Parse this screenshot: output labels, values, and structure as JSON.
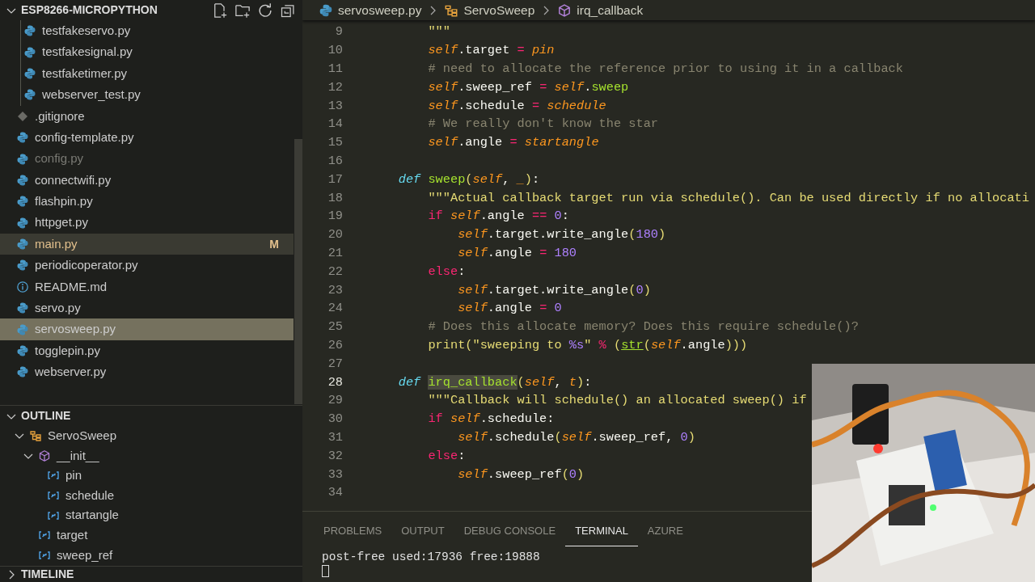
{
  "explorer": {
    "title": "ESP8266-MICROPYTHON",
    "expanded": true,
    "items": [
      {
        "children": [
          {
            "name": "testfakeservo.py",
            "kind": "python",
            "selected": false,
            "hovered": false,
            "modified": false,
            "ignored": false
          },
          {
            "name": "testfakesignal.py",
            "kind": "python",
            "selected": false,
            "hovered": false,
            "modified": false,
            "ignored": false
          },
          {
            "name": "testfaketimer.py",
            "kind": "python",
            "selected": false,
            "hovered": false,
            "modified": false,
            "ignored": false
          },
          {
            "name": "webserver_test.py",
            "kind": "python",
            "selected": false,
            "hovered": false,
            "modified": false,
            "ignored": false
          }
        ]
      },
      {
        "name": ".gitignore",
        "kind": "git",
        "selected": false,
        "hovered": false,
        "modified": false,
        "ignored": false
      },
      {
        "name": "config-template.py",
        "kind": "python",
        "selected": false,
        "hovered": false,
        "modified": false,
        "ignored": false
      },
      {
        "name": "config.py",
        "kind": "python",
        "selected": false,
        "hovered": false,
        "modified": false,
        "ignored": true
      },
      {
        "name": "connectwifi.py",
        "kind": "python",
        "selected": false,
        "hovered": false,
        "modified": false,
        "ignored": false
      },
      {
        "name": "flashpin.py",
        "kind": "python",
        "selected": false,
        "hovered": false,
        "modified": false,
        "ignored": false
      },
      {
        "name": "httpget.py",
        "kind": "python",
        "selected": false,
        "hovered": false,
        "modified": false,
        "ignored": false
      },
      {
        "name": "main.py",
        "kind": "python",
        "badge": "M",
        "selected": false,
        "hovered": true,
        "modified": true,
        "ignored": false
      },
      {
        "name": "periodicoperator.py",
        "kind": "python",
        "selected": false,
        "hovered": false,
        "modified": false,
        "ignored": false
      },
      {
        "name": "README.md",
        "kind": "info",
        "selected": false,
        "hovered": false,
        "modified": false,
        "ignored": false
      },
      {
        "name": "servo.py",
        "kind": "python",
        "selected": false,
        "hovered": false,
        "modified": false,
        "ignored": false
      },
      {
        "name": "servosweep.py",
        "kind": "python",
        "selected": true,
        "hovered": false,
        "modified": false,
        "ignored": false
      },
      {
        "name": "togglepin.py",
        "kind": "python",
        "selected": false,
        "hovered": false,
        "modified": false,
        "ignored": false
      },
      {
        "name": "webserver.py",
        "kind": "python",
        "selected": false,
        "hovered": false,
        "modified": false,
        "ignored": false
      }
    ]
  },
  "outline": {
    "title": "OUTLINE",
    "expanded": true,
    "items": [
      {
        "name": "ServoSweep",
        "kind": "class",
        "expanded": true,
        "children": [
          {
            "name": "__init__",
            "kind": "method",
            "expanded": true,
            "children": [
              {
                "name": "pin",
                "kind": "variable"
              },
              {
                "name": "schedule",
                "kind": "variable"
              },
              {
                "name": "startangle",
                "kind": "variable"
              }
            ]
          },
          {
            "name": "target",
            "kind": "variable"
          },
          {
            "name": "sweep_ref",
            "kind": "variable"
          }
        ]
      }
    ]
  },
  "timeline": {
    "title": "TIMELINE",
    "expanded": false
  },
  "editor": {
    "breadcrumb": [
      {
        "text": "servosweep.py",
        "kind": "python"
      },
      {
        "text": "ServoSweep",
        "kind": "class"
      },
      {
        "text": "irq_callback",
        "kind": "method"
      }
    ],
    "lines": [
      {
        "children": [
          {
            "children": [
              {
                "num": "9",
                "current": false,
                "tokens": [
                  {
                    "kind": "string",
                    "text": "\"\"\""
                  }
                ]
              },
              {
                "num": "10",
                "current": false,
                "tokens": [
                  {
                    "kind": "self",
                    "text": "self"
                  },
                  {
                    "kind": "plain",
                    "text": ".target "
                  },
                  {
                    "kind": "op",
                    "text": "="
                  },
                  {
                    "kind": "param",
                    "text": " pin"
                  }
                ]
              },
              {
                "num": "11",
                "current": false,
                "tokens": [
                  {
                    "kind": "comment",
                    "text": "# need to allocate the reference prior to using it in a callback"
                  }
                ]
              },
              {
                "num": "12",
                "current": false,
                "tokens": [
                  {
                    "kind": "self",
                    "text": "self"
                  },
                  {
                    "kind": "plain",
                    "text": ".sweep_ref "
                  },
                  {
                    "kind": "op",
                    "text": "= "
                  },
                  {
                    "kind": "self",
                    "text": "self"
                  },
                  {
                    "kind": "plain",
                    "text": "."
                  },
                  {
                    "kind": "attr",
                    "text": "sweep"
                  }
                ]
              },
              {
                "num": "13",
                "current": false,
                "tokens": [
                  {
                    "kind": "self",
                    "text": "self"
                  },
                  {
                    "kind": "plain",
                    "text": ".schedule "
                  },
                  {
                    "kind": "op",
                    "text": "="
                  },
                  {
                    "kind": "param",
                    "text": " schedule"
                  }
                ]
              },
              {
                "num": "14",
                "current": false,
                "tokens": [
                  {
                    "kind": "comment",
                    "text": "# We really don't know the star"
                  }
                ]
              },
              {
                "num": "15",
                "current": false,
                "tokens": [
                  {
                    "kind": "self",
                    "text": "self"
                  },
                  {
                    "kind": "plain",
                    "text": ".angle "
                  },
                  {
                    "kind": "op",
                    "text": "="
                  },
                  {
                    "kind": "param",
                    "text": " startangle"
                  }
                ]
              }
            ]
          },
          {
            "num": "16",
            "current": false
          },
          {
            "num": "17",
            "current": false,
            "tokens": [
              {
                "kind": "keyword",
                "text": "def"
              },
              {
                "kind": "func",
                "text": " sweep"
              },
              {
                "kind": "bracket",
                "text": "("
              },
              {
                "kind": "param",
                "text": "self"
              },
              {
                "kind": "plain",
                "text": ", "
              },
              {
                "kind": "param",
                "text": "_"
              },
              {
                "kind": "bracket",
                "text": ")"
              },
              {
                "kind": "plain",
                "text": ":"
              }
            ],
            "children": [
              {
                "num": "18",
                "current": false,
                "tokens": [
                  {
                    "kind": "string",
                    "text": "\"\"\"Actual callback target run via schedule(). Can be used directly if no allocati"
                  }
                ]
              },
              {
                "num": "19",
                "current": false,
                "tokens": [
                  {
                    "kind": "control",
                    "text": "if"
                  },
                  {
                    "kind": "self",
                    "text": " self"
                  },
                  {
                    "kind": "plain",
                    "text": ".angle "
                  },
                  {
                    "kind": "op",
                    "text": "=="
                  },
                  {
                    "kind": "number",
                    "text": " 0"
                  },
                  {
                    "kind": "plain",
                    "text": ":"
                  }
                ],
                "children": [
                  {
                    "num": "20",
                    "current": false,
                    "tokens": [
                      {
                        "kind": "self",
                        "text": "self"
                      },
                      {
                        "kind": "plain",
                        "text": ".target.write_angle"
                      },
                      {
                        "kind": "bracket",
                        "text": "("
                      },
                      {
                        "kind": "number",
                        "text": "180"
                      },
                      {
                        "kind": "bracket",
                        "text": ")"
                      }
                    ]
                  },
                  {
                    "num": "21",
                    "current": false,
                    "tokens": [
                      {
                        "kind": "self",
                        "text": "self"
                      },
                      {
                        "kind": "plain",
                        "text": ".angle "
                      },
                      {
                        "kind": "op",
                        "text": "="
                      },
                      {
                        "kind": "number",
                        "text": " 180"
                      }
                    ]
                  }
                ]
              },
              {
                "num": "22",
                "current": false,
                "tokens": [
                  {
                    "kind": "control",
                    "text": "else"
                  },
                  {
                    "kind": "plain",
                    "text": ":"
                  }
                ],
                "children": [
                  {
                    "num": "23",
                    "current": false,
                    "tokens": [
                      {
                        "kind": "self",
                        "text": "self"
                      },
                      {
                        "kind": "plain",
                        "text": ".target.write_angle"
                      },
                      {
                        "kind": "bracket",
                        "text": "("
                      },
                      {
                        "kind": "number",
                        "text": "0"
                      },
                      {
                        "kind": "bracket",
                        "text": ")"
                      }
                    ]
                  },
                  {
                    "num": "24",
                    "current": false,
                    "tokens": [
                      {
                        "kind": "self",
                        "text": "self"
                      },
                      {
                        "kind": "plain",
                        "text": ".angle "
                      },
                      {
                        "kind": "op",
                        "text": "="
                      },
                      {
                        "kind": "number",
                        "text": " 0"
                      }
                    ]
                  }
                ]
              },
              {
                "num": "25",
                "current": false,
                "tokens": [
                  {
                    "kind": "comment",
                    "text": "# Does this allocate memory? Does this require schedule()?"
                  }
                ]
              },
              {
                "num": "26",
                "current": false,
                "tokens": [
                  {
                    "kind": "string",
                    "text": "print"
                  },
                  {
                    "kind": "bracket",
                    "text": "("
                  },
                  {
                    "kind": "string",
                    "text": "\"sweeping to "
                  },
                  {
                    "kind": "number",
                    "text": "%s"
                  },
                  {
                    "kind": "string",
                    "text": "\""
                  },
                  {
                    "kind": "op",
                    "text": " % "
                  },
                  {
                    "kind": "bracket",
                    "text": "("
                  },
                  {
                    "kind": "builtin",
                    "text": "str"
                  },
                  {
                    "kind": "bracket",
                    "text": "("
                  },
                  {
                    "kind": "self",
                    "text": "self"
                  },
                  {
                    "kind": "plain",
                    "text": ".angle"
                  },
                  {
                    "kind": "bracket",
                    "text": ")))"
                  }
                ]
              }
            ]
          },
          {
            "num": "27",
            "current": false
          },
          {
            "num": "28",
            "current": true,
            "tokens": [
              {
                "kind": "keyword",
                "text": "def "
              },
              {
                "kind": "highlight",
                "text": "irq_callback"
              },
              {
                "kind": "bracket",
                "text": "("
              },
              {
                "kind": "param",
                "text": "self"
              },
              {
                "kind": "plain",
                "text": ", "
              },
              {
                "kind": "param",
                "text": "t"
              },
              {
                "kind": "bracket",
                "text": ")"
              },
              {
                "kind": "plain",
                "text": ":"
              }
            ],
            "children": [
              {
                "num": "29",
                "current": false,
                "tokens": [
                  {
                    "kind": "string",
                    "text": "\"\"\"Callback will schedule() an allocated sweep() if"
                  }
                ]
              },
              {
                "num": "30",
                "current": false,
                "tokens": [
                  {
                    "kind": "control",
                    "text": "if"
                  },
                  {
                    "kind": "self",
                    "text": " self"
                  },
                  {
                    "kind": "plain",
                    "text": ".schedule:"
                  }
                ],
                "children": [
                  {
                    "num": "31",
                    "current": false,
                    "tokens": [
                      {
                        "kind": "self",
                        "text": "self"
                      },
                      {
                        "kind": "plain",
                        "text": ".schedule"
                      },
                      {
                        "kind": "bracket",
                        "text": "("
                      },
                      {
                        "kind": "self",
                        "text": "self"
                      },
                      {
                        "kind": "plain",
                        "text": ".sweep_ref, "
                      },
                      {
                        "kind": "number",
                        "text": "0"
                      },
                      {
                        "kind": "bracket",
                        "text": ")"
                      }
                    ]
                  }
                ]
              },
              {
                "num": "32",
                "current": false,
                "tokens": [
                  {
                    "kind": "control",
                    "text": "else"
                  },
                  {
                    "kind": "plain",
                    "text": ":"
                  }
                ],
                "children": [
                  {
                    "num": "33",
                    "current": false,
                    "tokens": [
                      {
                        "kind": "self",
                        "text": "self"
                      },
                      {
                        "kind": "plain",
                        "text": ".sweep_ref"
                      },
                      {
                        "kind": "bracket",
                        "text": "("
                      },
                      {
                        "kind": "number",
                        "text": "0"
                      },
                      {
                        "kind": "bracket",
                        "text": ")"
                      }
                    ]
                  }
                ]
              }
            ]
          },
          {
            "num": "34",
            "current": false
          }
        ]
      }
    ]
  },
  "panel": {
    "tabs": [
      {
        "label": "PROBLEMS",
        "selected": false
      },
      {
        "label": "OUTPUT",
        "selected": false
      },
      {
        "label": "DEBUG CONSOLE",
        "selected": false
      },
      {
        "label": "TERMINAL",
        "selected": true
      },
      {
        "label": "AZURE",
        "selected": false
      }
    ],
    "terminal": {
      "lines": [
        "post-free used:17936 free:19888"
      ],
      "cursor": true
    }
  }
}
